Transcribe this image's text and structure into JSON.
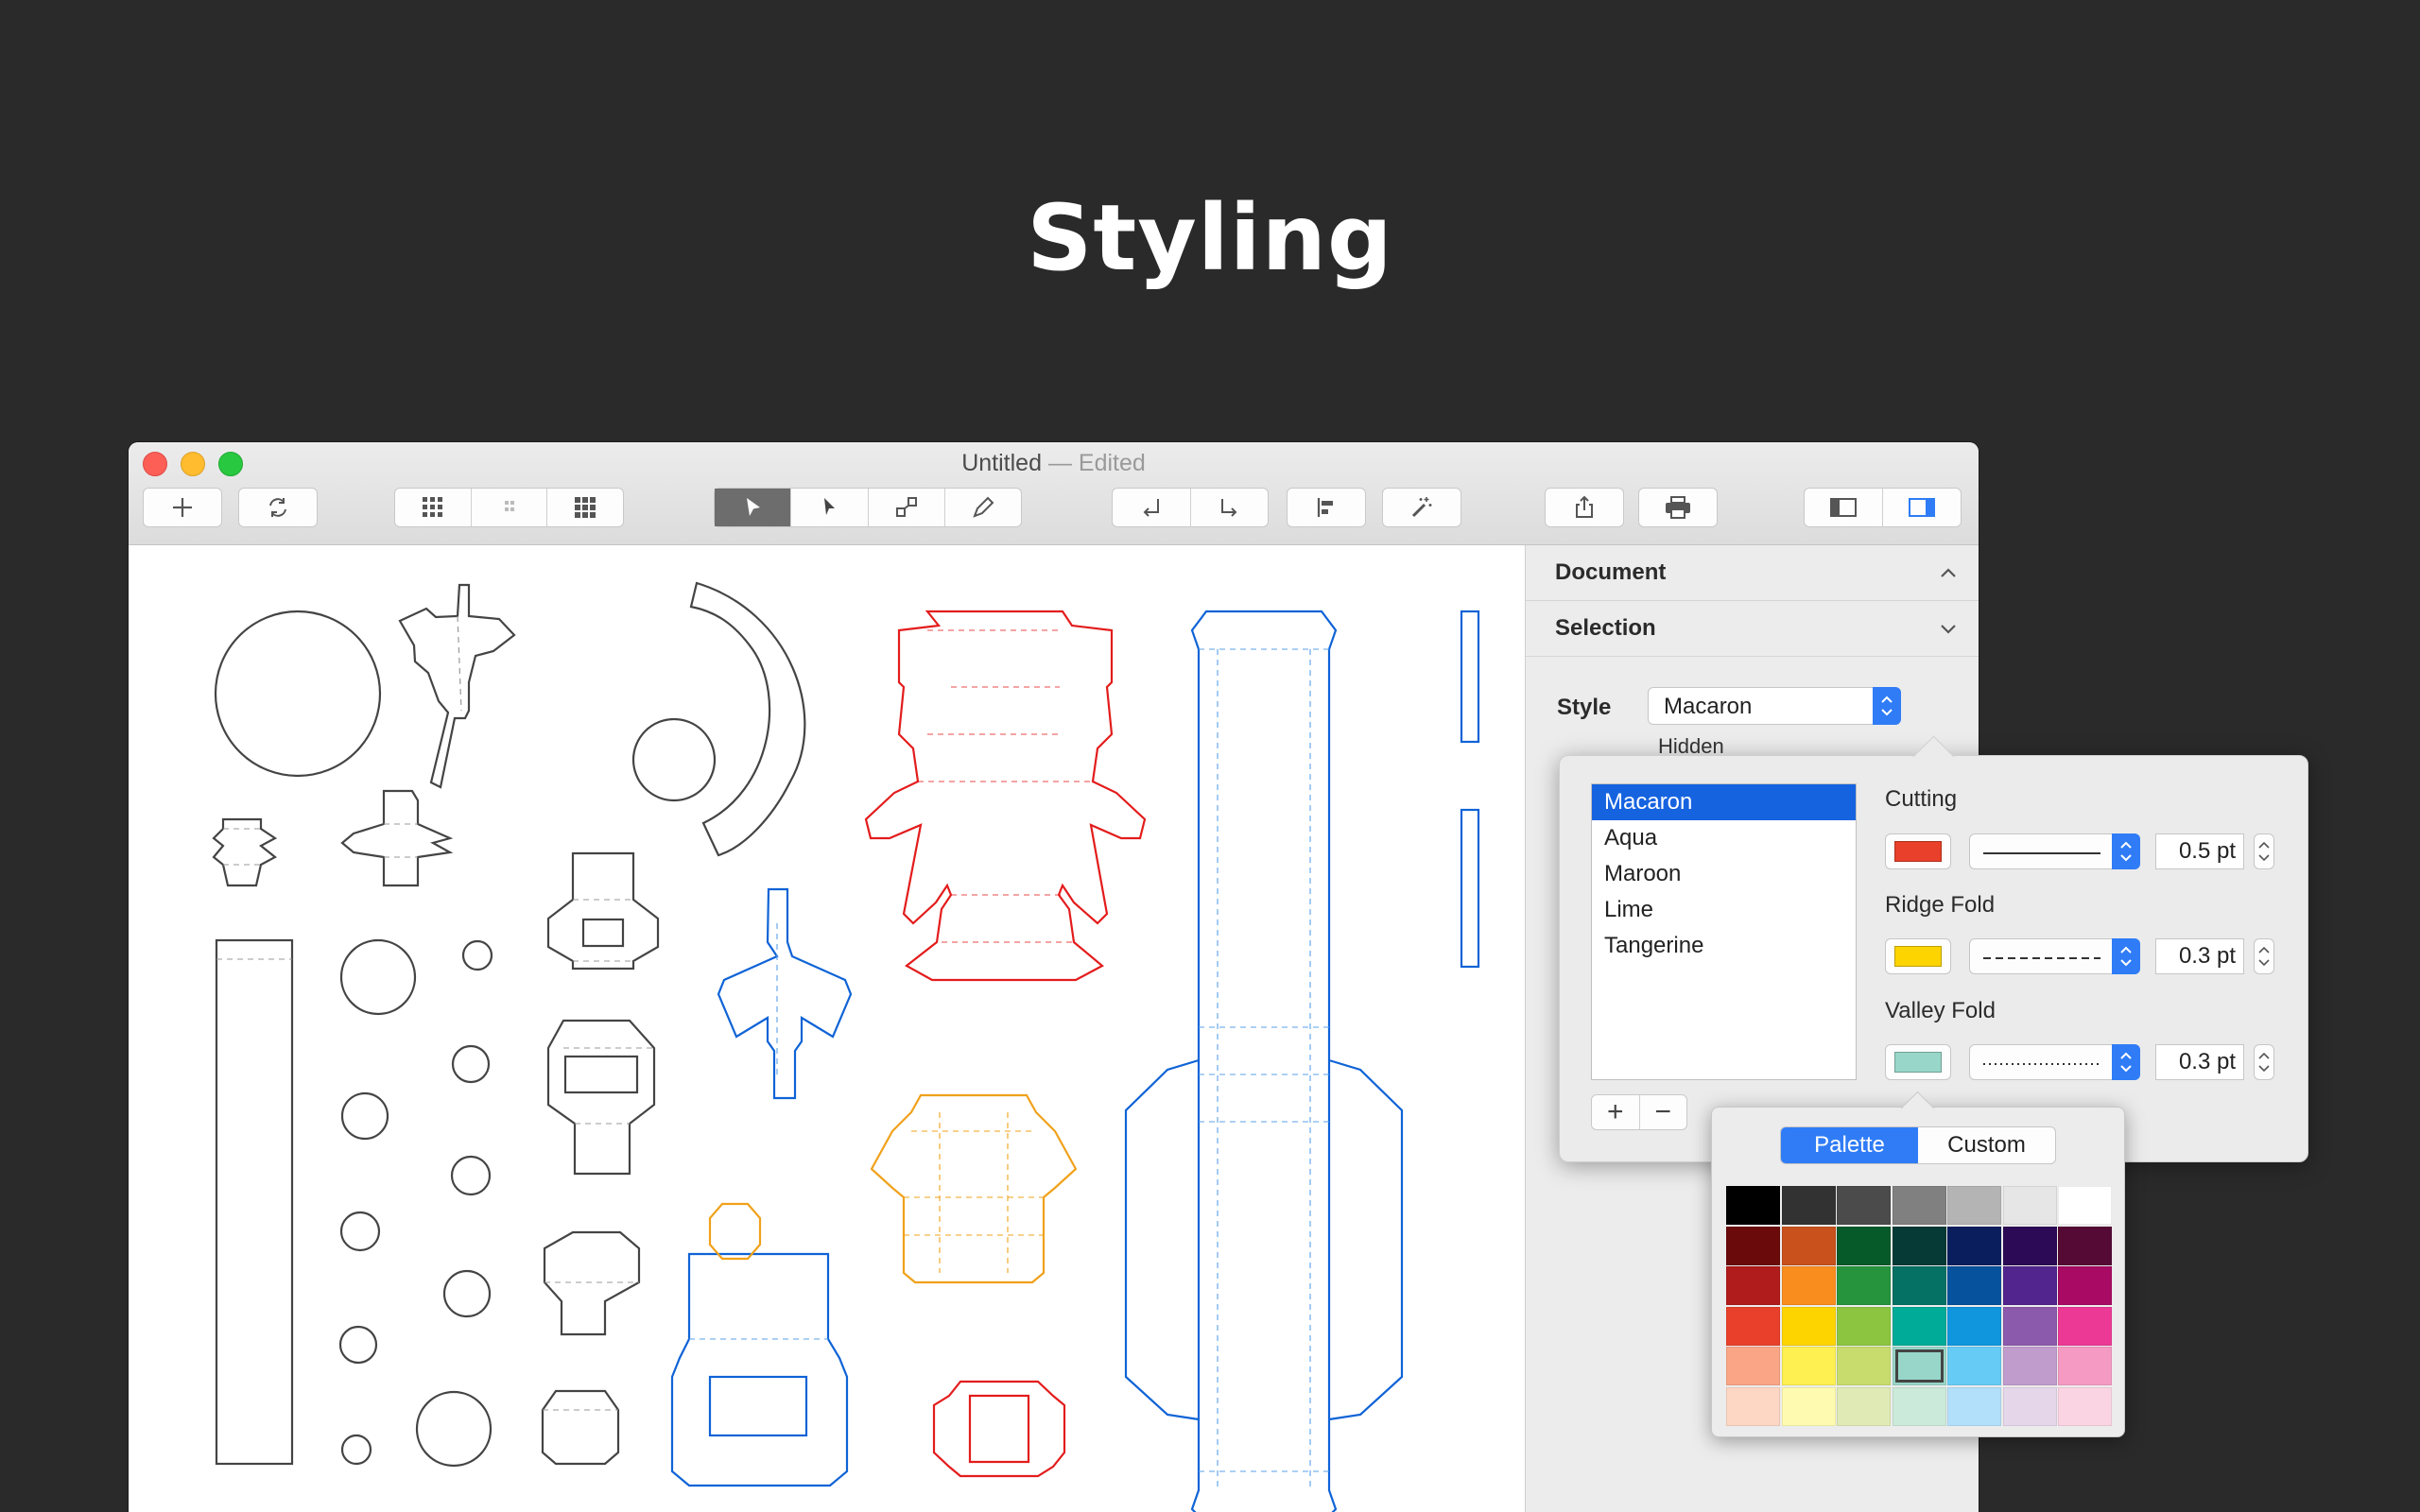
{
  "headline": "Styling",
  "window": {
    "title": "Untitled",
    "separator": "—",
    "edited": "Edited"
  },
  "toolbar": {
    "groups": [
      [
        "plus-icon"
      ],
      [
        "refresh-icon"
      ],
      [
        "grid-icon",
        "grid-sparse-icon",
        "grid-dense-icon"
      ],
      [
        "select-arrow-icon",
        "direct-select-icon",
        "transform-icon",
        "pen-icon"
      ],
      [
        "undo-icon",
        "redo-icon"
      ],
      [
        "align-left-icon"
      ],
      [
        "magic-wand-icon"
      ],
      [
        "share-icon"
      ],
      [
        "print-icon"
      ],
      [
        "left-sidebar-icon",
        "right-sidebar-icon"
      ]
    ],
    "active_tool": "select-arrow-icon"
  },
  "sidebar": {
    "document_label": "Document",
    "selection_label": "Selection",
    "style_label": "Style",
    "style_value": "Macaron",
    "hidden_label": "Hidden"
  },
  "style_popover": {
    "styles": [
      "Macaron",
      "Aqua",
      "Maroon",
      "Lime",
      "Tangerine"
    ],
    "selected_style": "Macaron",
    "rows": [
      {
        "label": "Cutting",
        "color": "#e8402a",
        "line": "solid",
        "width": "0.5 pt"
      },
      {
        "label": "Ridge Fold",
        "color": "#fdd400",
        "line": "dashed",
        "width": "0.3 pt"
      },
      {
        "label": "Valley Fold",
        "color": "#97d6c8",
        "line": "dotted",
        "width": "0.3 pt"
      }
    ],
    "add_label": "+",
    "remove_label": "−"
  },
  "color_popover": {
    "tabs": [
      "Palette",
      "Custom"
    ],
    "active_tab": "Palette",
    "selected_color": "#97d6c8",
    "palette": [
      [
        "#000000",
        "#323232",
        "#4b4b4b",
        "#808080",
        "#b4b4b4",
        "#e6e6e6",
        "#ffffff"
      ],
      [
        "#6a0a0a",
        "#c8511c",
        "#065a2a",
        "#053a37",
        "#0a1e5e",
        "#2c0a55",
        "#550a35"
      ],
      [
        "#b01c1c",
        "#f98d1e",
        "#25943c",
        "#057164",
        "#07529c",
        "#52258e",
        "#a80a64"
      ],
      [
        "#e8402a",
        "#fdd400",
        "#8cc540",
        "#00ab98",
        "#0f96dd",
        "#8c5aac",
        "#ec3996"
      ],
      [
        "#f9a586",
        "#fef050",
        "#c8dc6e",
        "#97d6c8",
        "#66ccf5",
        "#c09ccd",
        "#f59bc3"
      ],
      [
        "#fdd6c4",
        "#fefbb0",
        "#e0eab4",
        "#cbeada",
        "#b2e0fa",
        "#e6d6ea",
        "#fbd4e4"
      ]
    ]
  }
}
